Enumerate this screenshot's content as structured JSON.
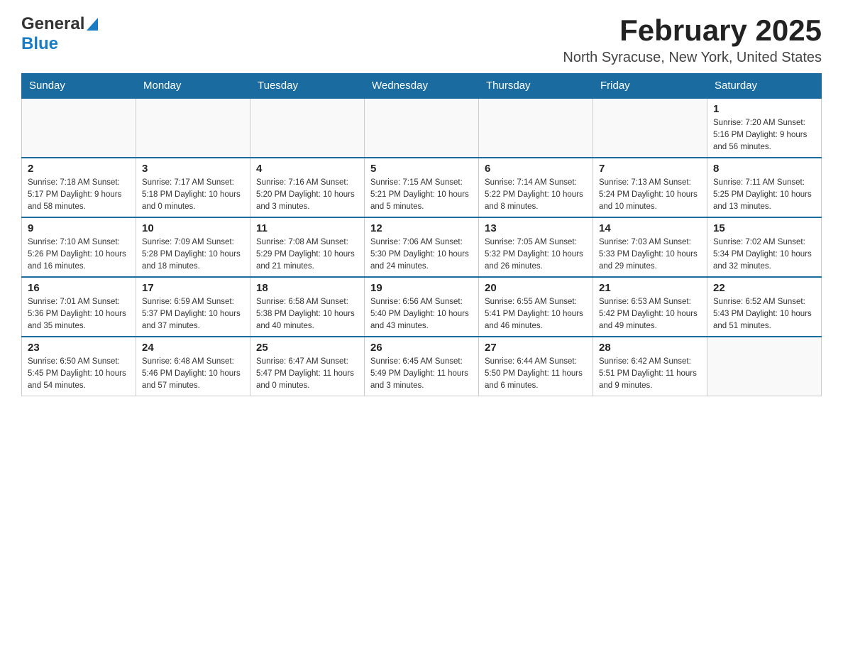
{
  "header": {
    "logo_general": "General",
    "logo_blue": "Blue",
    "month_title": "February 2025",
    "location": "North Syracuse, New York, United States"
  },
  "weekdays": [
    "Sunday",
    "Monday",
    "Tuesday",
    "Wednesday",
    "Thursday",
    "Friday",
    "Saturday"
  ],
  "weeks": [
    [
      {
        "day": "",
        "info": ""
      },
      {
        "day": "",
        "info": ""
      },
      {
        "day": "",
        "info": ""
      },
      {
        "day": "",
        "info": ""
      },
      {
        "day": "",
        "info": ""
      },
      {
        "day": "",
        "info": ""
      },
      {
        "day": "1",
        "info": "Sunrise: 7:20 AM\nSunset: 5:16 PM\nDaylight: 9 hours and 56 minutes."
      }
    ],
    [
      {
        "day": "2",
        "info": "Sunrise: 7:18 AM\nSunset: 5:17 PM\nDaylight: 9 hours and 58 minutes."
      },
      {
        "day": "3",
        "info": "Sunrise: 7:17 AM\nSunset: 5:18 PM\nDaylight: 10 hours and 0 minutes."
      },
      {
        "day": "4",
        "info": "Sunrise: 7:16 AM\nSunset: 5:20 PM\nDaylight: 10 hours and 3 minutes."
      },
      {
        "day": "5",
        "info": "Sunrise: 7:15 AM\nSunset: 5:21 PM\nDaylight: 10 hours and 5 minutes."
      },
      {
        "day": "6",
        "info": "Sunrise: 7:14 AM\nSunset: 5:22 PM\nDaylight: 10 hours and 8 minutes."
      },
      {
        "day": "7",
        "info": "Sunrise: 7:13 AM\nSunset: 5:24 PM\nDaylight: 10 hours and 10 minutes."
      },
      {
        "day": "8",
        "info": "Sunrise: 7:11 AM\nSunset: 5:25 PM\nDaylight: 10 hours and 13 minutes."
      }
    ],
    [
      {
        "day": "9",
        "info": "Sunrise: 7:10 AM\nSunset: 5:26 PM\nDaylight: 10 hours and 16 minutes."
      },
      {
        "day": "10",
        "info": "Sunrise: 7:09 AM\nSunset: 5:28 PM\nDaylight: 10 hours and 18 minutes."
      },
      {
        "day": "11",
        "info": "Sunrise: 7:08 AM\nSunset: 5:29 PM\nDaylight: 10 hours and 21 minutes."
      },
      {
        "day": "12",
        "info": "Sunrise: 7:06 AM\nSunset: 5:30 PM\nDaylight: 10 hours and 24 minutes."
      },
      {
        "day": "13",
        "info": "Sunrise: 7:05 AM\nSunset: 5:32 PM\nDaylight: 10 hours and 26 minutes."
      },
      {
        "day": "14",
        "info": "Sunrise: 7:03 AM\nSunset: 5:33 PM\nDaylight: 10 hours and 29 minutes."
      },
      {
        "day": "15",
        "info": "Sunrise: 7:02 AM\nSunset: 5:34 PM\nDaylight: 10 hours and 32 minutes."
      }
    ],
    [
      {
        "day": "16",
        "info": "Sunrise: 7:01 AM\nSunset: 5:36 PM\nDaylight: 10 hours and 35 minutes."
      },
      {
        "day": "17",
        "info": "Sunrise: 6:59 AM\nSunset: 5:37 PM\nDaylight: 10 hours and 37 minutes."
      },
      {
        "day": "18",
        "info": "Sunrise: 6:58 AM\nSunset: 5:38 PM\nDaylight: 10 hours and 40 minutes."
      },
      {
        "day": "19",
        "info": "Sunrise: 6:56 AM\nSunset: 5:40 PM\nDaylight: 10 hours and 43 minutes."
      },
      {
        "day": "20",
        "info": "Sunrise: 6:55 AM\nSunset: 5:41 PM\nDaylight: 10 hours and 46 minutes."
      },
      {
        "day": "21",
        "info": "Sunrise: 6:53 AM\nSunset: 5:42 PM\nDaylight: 10 hours and 49 minutes."
      },
      {
        "day": "22",
        "info": "Sunrise: 6:52 AM\nSunset: 5:43 PM\nDaylight: 10 hours and 51 minutes."
      }
    ],
    [
      {
        "day": "23",
        "info": "Sunrise: 6:50 AM\nSunset: 5:45 PM\nDaylight: 10 hours and 54 minutes."
      },
      {
        "day": "24",
        "info": "Sunrise: 6:48 AM\nSunset: 5:46 PM\nDaylight: 10 hours and 57 minutes."
      },
      {
        "day": "25",
        "info": "Sunrise: 6:47 AM\nSunset: 5:47 PM\nDaylight: 11 hours and 0 minutes."
      },
      {
        "day": "26",
        "info": "Sunrise: 6:45 AM\nSunset: 5:49 PM\nDaylight: 11 hours and 3 minutes."
      },
      {
        "day": "27",
        "info": "Sunrise: 6:44 AM\nSunset: 5:50 PM\nDaylight: 11 hours and 6 minutes."
      },
      {
        "day": "28",
        "info": "Sunrise: 6:42 AM\nSunset: 5:51 PM\nDaylight: 11 hours and 9 minutes."
      },
      {
        "day": "",
        "info": ""
      }
    ]
  ]
}
